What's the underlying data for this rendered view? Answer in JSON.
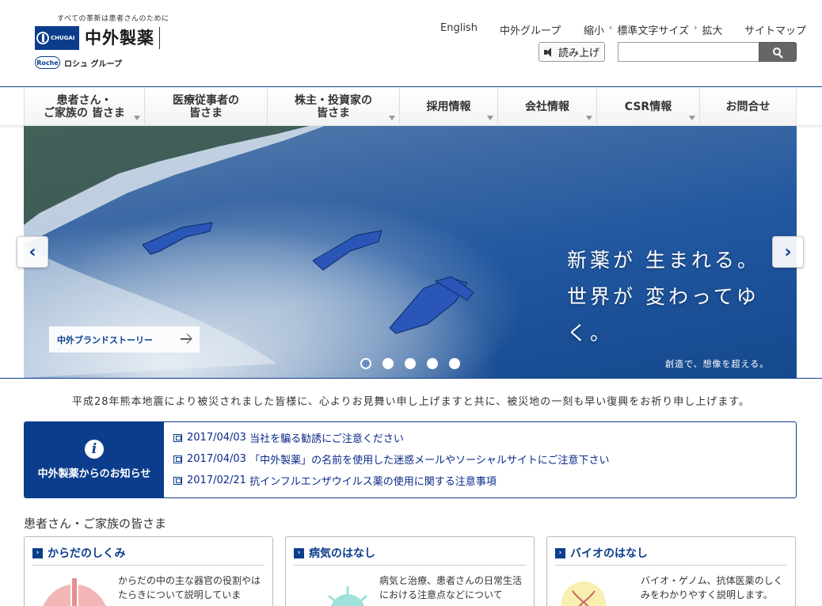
{
  "header": {
    "tagline": "すべての革新は患者さんのために",
    "logo_mark_text": "CHUGAI",
    "logo_name": "中外製薬",
    "roche_mark": "Roche",
    "roche_group": "ロシュ グループ",
    "links": {
      "english": "English",
      "group": "中外グループ",
      "shrink": "縮小",
      "standard": "標準文字サイズ",
      "enlarge": "拡大",
      "sitemap": "サイトマップ"
    },
    "read_aloud": "読み上げ",
    "search_placeholder": ""
  },
  "nav": [
    {
      "line1": "患者さん・",
      "line2": "ご家族の 皆さま"
    },
    {
      "line1": "医療従事者の",
      "line2": "皆さま"
    },
    {
      "line1": "株主・投資家の",
      "line2": "皆さま"
    },
    {
      "line1": "採用情報",
      "line2": ""
    },
    {
      "line1": "会社情報",
      "line2": ""
    },
    {
      "line1": "CSR情報",
      "line2": ""
    },
    {
      "line1": "お問合せ",
      "line2": ""
    }
  ],
  "hero": {
    "copy_line1": "新薬が 生まれる。",
    "copy_line2": "世界が 変わってゆく。",
    "sub": "創造で、想像を超える。",
    "story_button": "中外ブランドストーリー",
    "prev": "‹",
    "next": "›",
    "slide_count": 5,
    "active_slide": 1
  },
  "quake_message": "平成28年熊本地震により被災されました皆様に、心よりお見舞い申し上げますと共に、被災地の一刻も早い復興をお祈り申し上げます。",
  "notice": {
    "icon": "i",
    "title": "中外製薬からのお知らせ",
    "items": [
      {
        "date": "2017/04/03",
        "text": "当社を騙る勧誘にご注意ください"
      },
      {
        "date": "2017/04/03",
        "text": "「中外製薬」の名前を使用した迷惑メールやソーシャルサイトにご注意下さい"
      },
      {
        "date": "2017/02/21",
        "text": "抗インフルエンザウイルス薬の使用に関する注意事項"
      }
    ]
  },
  "section_title": "患者さん・ご家族の皆さま",
  "cards": [
    {
      "title": "からだのしくみ",
      "text": "からだの中の主な器官の役割やはたらきについて説明していま"
    },
    {
      "title": "病気のはなし",
      "text": "病気と治療、患者さんの日常生活における注意点などについて"
    },
    {
      "title": "バイオのはなし",
      "text": "バイオ・ゲノム、抗体医薬のしくみをわかりやすく説明します。"
    }
  ],
  "colors": {
    "brand_blue": "#0b3d8c",
    "link_blue": "#0a2a8a"
  }
}
